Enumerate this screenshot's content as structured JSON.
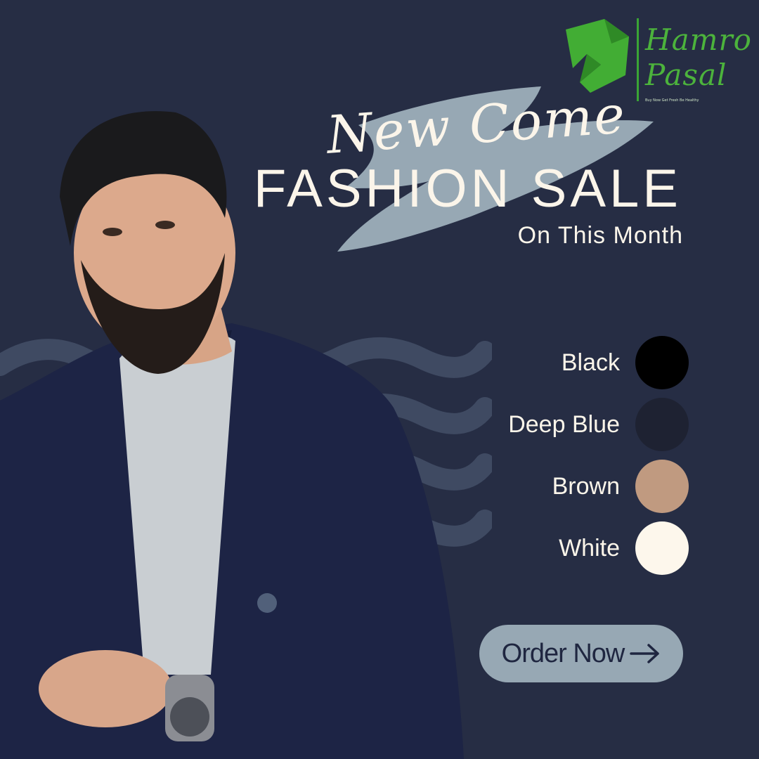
{
  "brand": {
    "name_line1": "Hamro",
    "name_line2": "Pasal",
    "tagline": "Buy Now Get Fresh Be Healthy",
    "color": "#4cb33c"
  },
  "hero": {
    "script_title": "New Come",
    "headline": "FASHION SALE",
    "subline": "On This Month",
    "brush_color": "#97a8b4"
  },
  "colors": [
    {
      "label": "Black",
      "hex": "#000000"
    },
    {
      "label": "Deep Blue",
      "hex": "#1e2232"
    },
    {
      "label": "Brown",
      "hex": "#c09a80"
    },
    {
      "label": "White",
      "hex": "#fdf7ec"
    }
  ],
  "cta": {
    "label": "Order Now",
    "icon": "arrow-right-icon"
  },
  "theme": {
    "background": "#262d44",
    "text": "#fbf5ea"
  }
}
